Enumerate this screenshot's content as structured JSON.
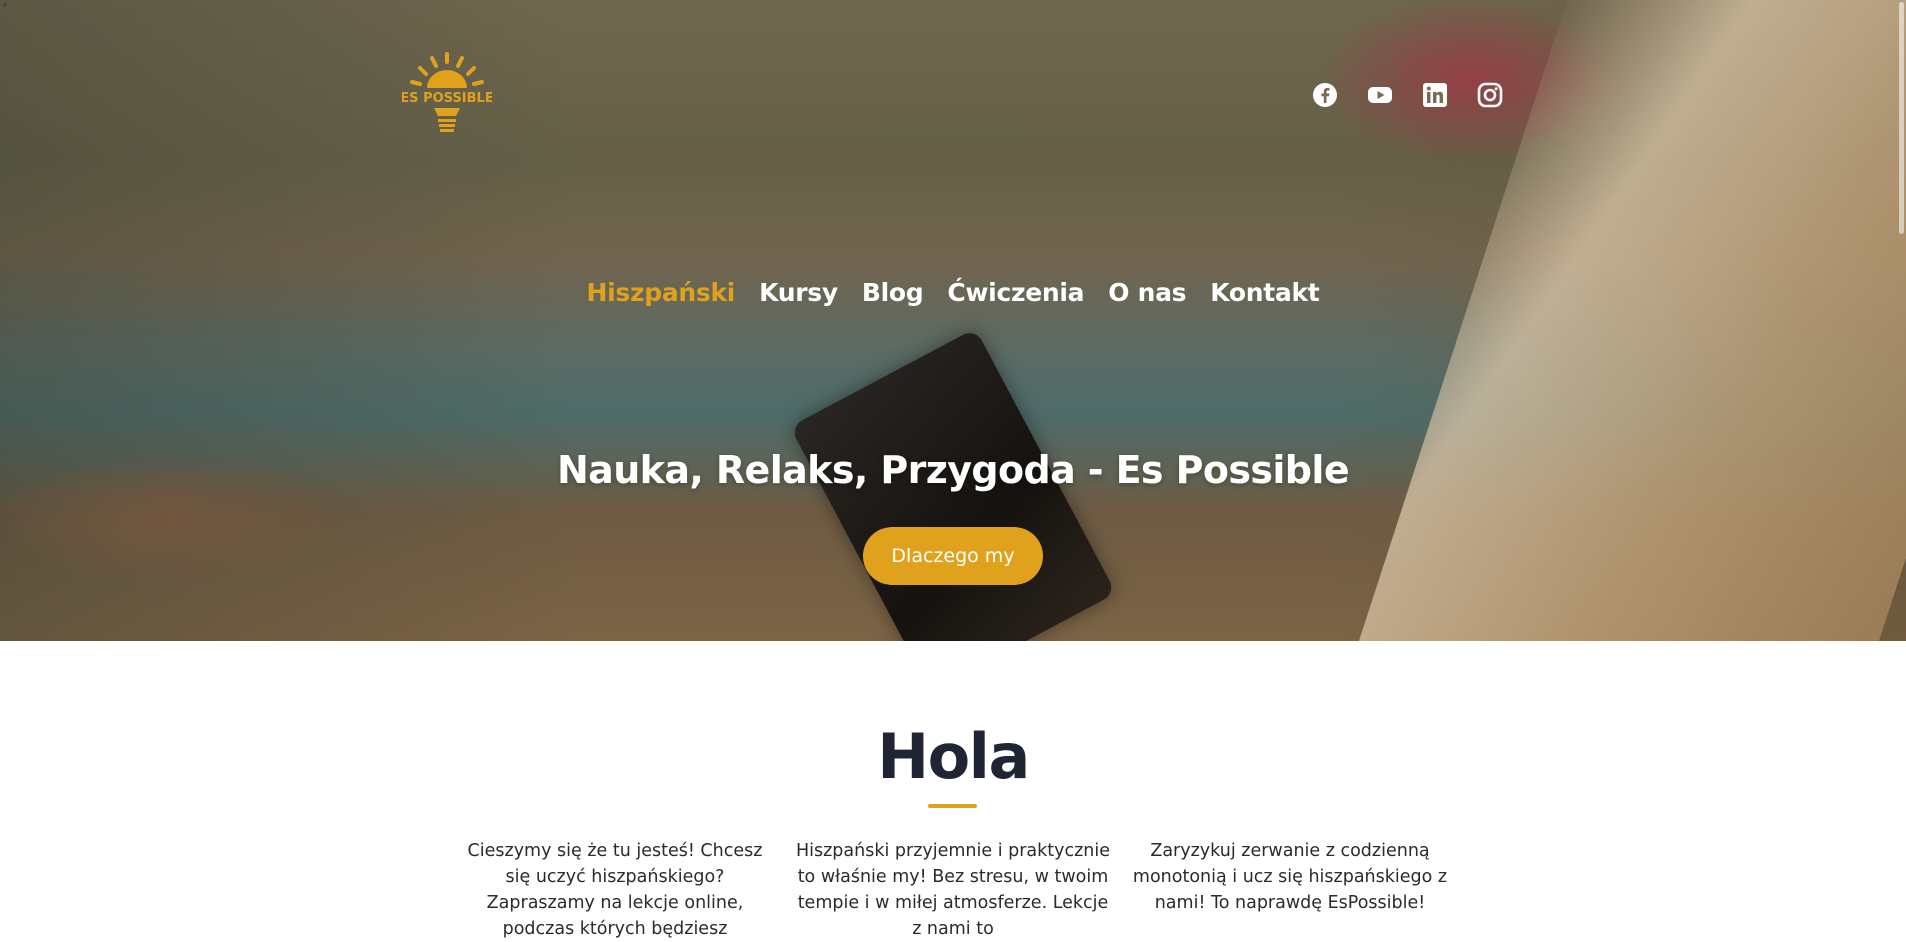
{
  "brand": {
    "logo_text": "ES POSSIBLE",
    "accent": "#e0a21d",
    "title_color": "#1f2535"
  },
  "social": [
    {
      "icon": "facebook-icon"
    },
    {
      "icon": "youtube-icon"
    },
    {
      "icon": "linkedin-icon"
    },
    {
      "icon": "instagram-icon"
    }
  ],
  "nav": {
    "items": [
      {
        "label": "Hiszpański",
        "active": true
      },
      {
        "label": "Kursy"
      },
      {
        "label": "Blog"
      },
      {
        "label": "Ćwiczenia"
      },
      {
        "label": "O nas"
      },
      {
        "label": "Kontakt"
      }
    ]
  },
  "hero": {
    "title": "Nauka, Relaks, Przygoda - Es Possible",
    "cta_label": "Dlaczego my"
  },
  "intro": {
    "title": "Hola",
    "columns": [
      "Cieszymy się że tu jesteś! Chcesz się uczyć hiszpańskiego? Zapraszamy na lekcje online, podczas których będziesz",
      "Hiszpański przyjemnie i praktycznie to właśnie my! Bez stresu, w twoim tempie i w miłej atmosferze. Lekcje z nami to",
      "Zaryzykuj zerwanie z codzienną monotonią i ucz się hiszpańskiego z nami! To naprawdę EsPossible!"
    ]
  },
  "corner_mark": "×"
}
